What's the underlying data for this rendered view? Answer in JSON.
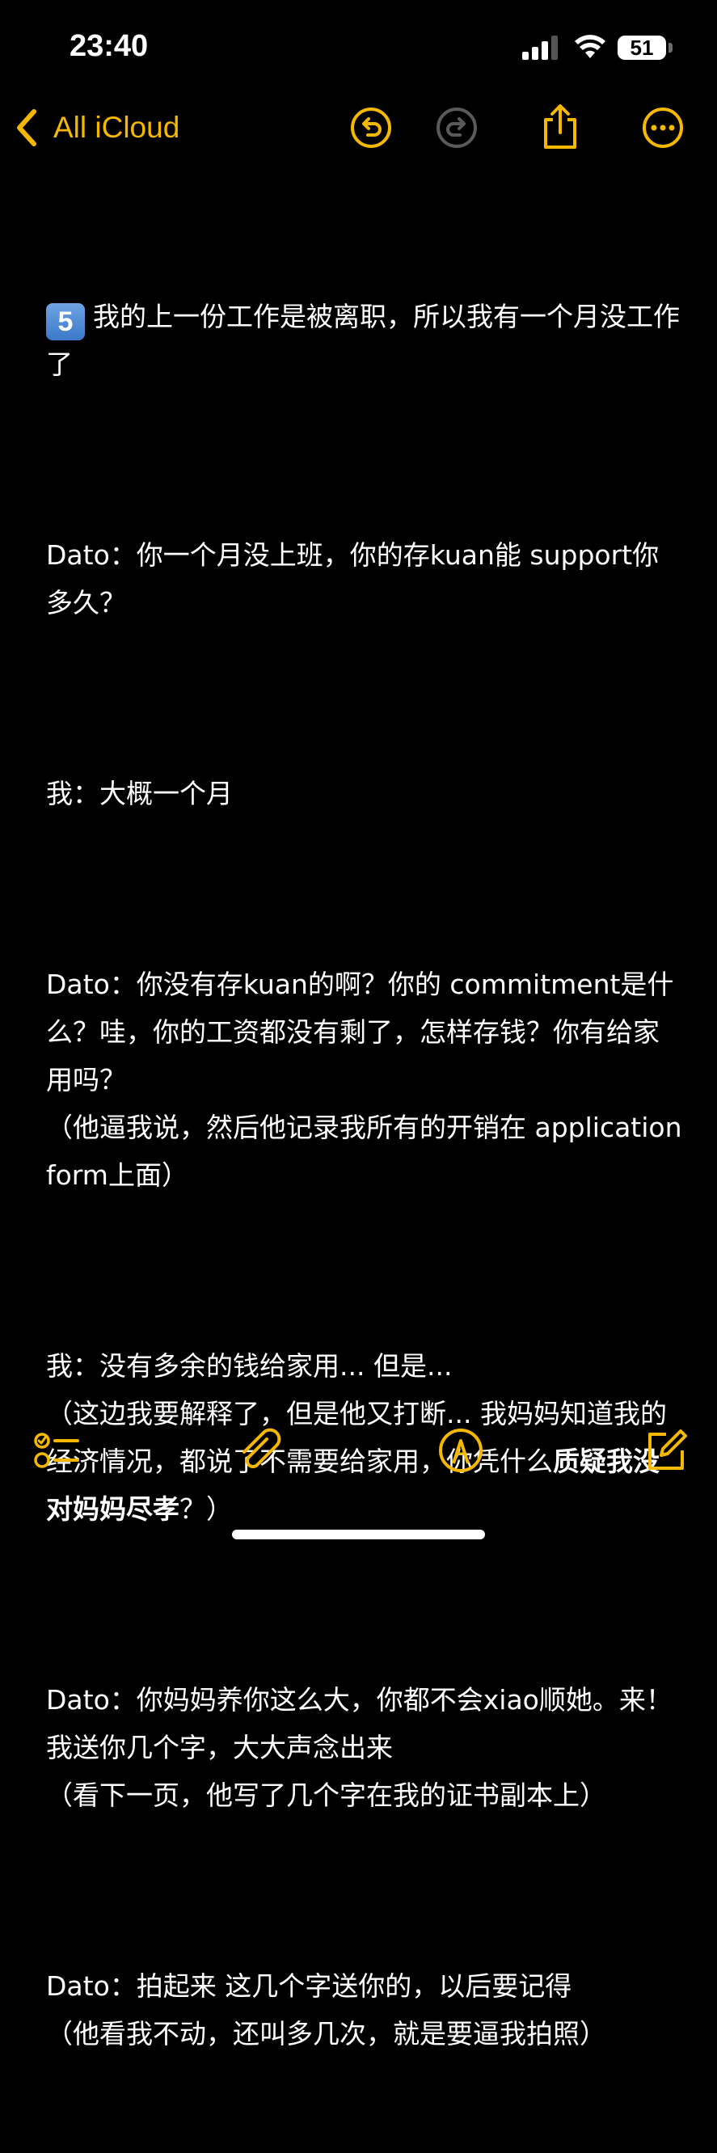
{
  "status_bar": {
    "time": "23:40",
    "battery": "51",
    "icons": [
      "signal-icon",
      "wifi-icon",
      "battery-icon"
    ]
  },
  "nav": {
    "back_label": "All iCloud",
    "accent": "#f5b800",
    "icons": [
      "undo-icon",
      "redo-icon",
      "share-icon",
      "more-icon"
    ]
  },
  "note": {
    "emoji_num": "5",
    "p1": "我的上一份工作是被离职，所以我有一个月没工作了",
    "p2": "Dato：你一个月没上班，你的存kuan能 support你多久？",
    "p3": "我：大概一个月",
    "p4a": "Dato：你没有存kuan的啊？你的 commitment是什么？哇，你的工资都没有剩了，怎样存钱？你有给家用吗？",
    "p4b": "（他逼我说，然后他记录我所有的开销在 application form上面）",
    "p5a": "我：没有多余的钱给家用... 但是...",
    "p5b": "（这边我要解释了，但是他又打断... 我妈妈知道我的经济情况，都说了不需要给家用，你凭什么",
    "p5c": "质疑我没对妈妈尽孝",
    "p5d": "？）",
    "p6a": "Dato：你妈妈养你这么大，你都不会xiao顺她。来！我送你几个字，大大声念出来",
    "p6b": "（看下一页，他写了几个字在我的证书副本上）",
    "p7a": "Dato：拍起来 这几个字送你的，以后要记得",
    "p7b": "（他看我不动，还叫多几次，就是要逼我拍照）"
  },
  "toolbar": {
    "icons": [
      "checklist-icon",
      "attachment-icon",
      "markup-icon",
      "compose-icon"
    ]
  }
}
